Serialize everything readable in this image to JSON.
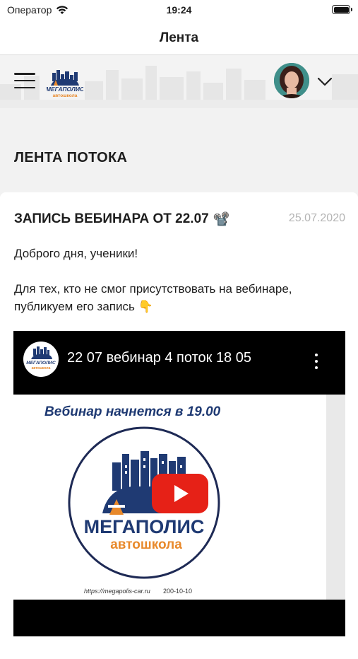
{
  "status": {
    "carrier": "Оператор",
    "time": "19:24"
  },
  "nav": {
    "title": "Лента"
  },
  "header": {
    "logo_text_top": "МЕГАПОЛИС",
    "logo_text_bottom": "автошкола"
  },
  "feed": {
    "section_title": "ЛЕНТА ПОТОКА"
  },
  "post": {
    "title": "ЗАПИСЬ ВЕБИНАРА ОТ 22.07",
    "title_emoji": "📽️",
    "date": "25.07.2020",
    "paragraph1": "Доброго дня, ученики!",
    "paragraph2": "Для тех, кто не смог присутствовать на вебинаре, публикуем его запись 👇"
  },
  "video": {
    "title": "22 07 вебинар 4 поток 18 05",
    "caption": "Вебинар начнется в 19.00",
    "brand_top": "МЕГАПОЛИС",
    "brand_bottom": "автошкола",
    "site": "https://megapolis-car.ru",
    "phone": "200-10-10"
  },
  "colors": {
    "accent_orange": "#e8892b",
    "brand_navy": "#1f3a73",
    "youtube_red": "#e62117"
  }
}
